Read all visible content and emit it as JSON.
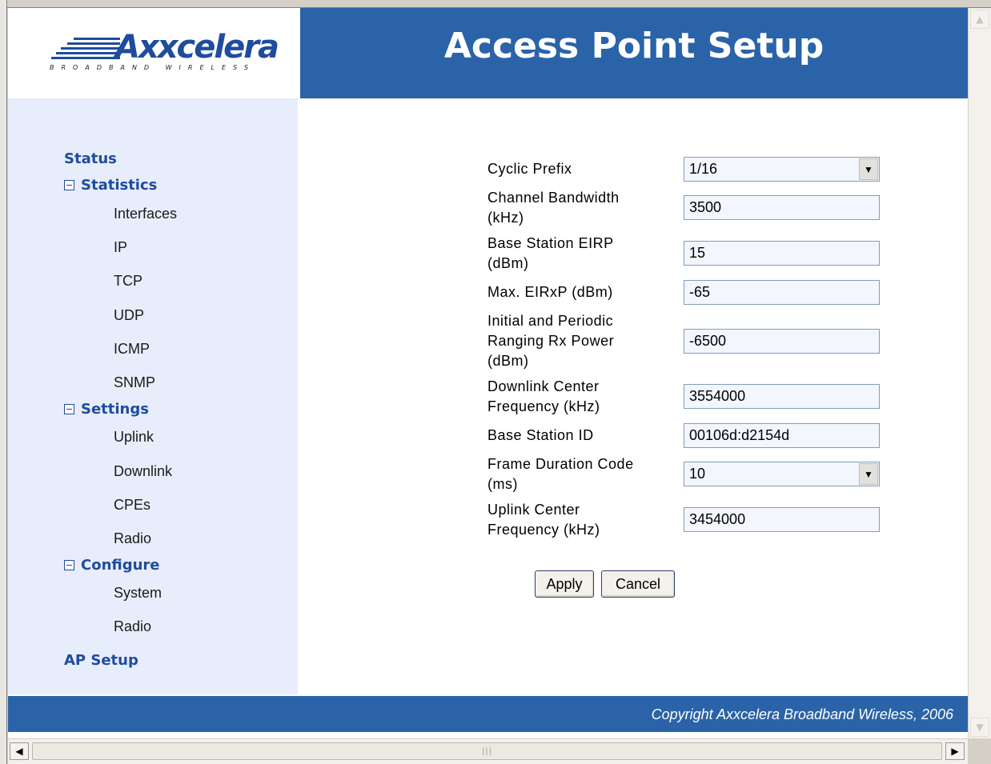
{
  "branding": {
    "logo_name": "Axxcelera",
    "logo_tagline": "BROADBAND WIRELESS",
    "brand_color": "#1f4c9c",
    "header_color": "#2a63a8"
  },
  "header": {
    "title": "Access Point Setup"
  },
  "sidebar": {
    "status": "Status",
    "statistics": {
      "label": "Statistics",
      "items": [
        "Interfaces",
        "IP",
        "TCP",
        "UDP",
        "ICMP",
        "SNMP"
      ]
    },
    "settings": {
      "label": "Settings",
      "items": [
        "Uplink",
        "Downlink",
        "CPEs",
        "Radio"
      ]
    },
    "configure": {
      "label": "Configure",
      "items": [
        "System",
        "Radio"
      ]
    },
    "ap_setup": "AP Setup"
  },
  "form": {
    "cyclic_prefix": {
      "label": "Cyclic Prefix",
      "value": "1/16"
    },
    "channel_bandwidth": {
      "label": "Channel Bandwidth (kHz)",
      "value": "3500"
    },
    "base_station_eirp": {
      "label": "Base Station EIRP (dBm)",
      "value": "15"
    },
    "max_eirxp": {
      "label": "Max. EIRxP (dBm)",
      "value": "-65"
    },
    "ranging_rx_power": {
      "label": "Initial and Periodic Ranging Rx Power (dBm)",
      "value": "-6500"
    },
    "downlink_center_freq": {
      "label": "Downlink Center Frequency (kHz)",
      "value": "3554000"
    },
    "base_station_id": {
      "label": "Base Station ID",
      "value": "00106d:d2154d"
    },
    "frame_duration_code": {
      "label": "Frame Duration Code (ms)",
      "value": "10"
    },
    "uplink_center_freq": {
      "label": "Uplink Center Frequency (kHz)",
      "value": "3454000"
    }
  },
  "buttons": {
    "apply": "Apply",
    "cancel": "Cancel"
  },
  "footer": {
    "copyright": "Copyright Axxcelera Broadband Wireless, 2006"
  },
  "icons": {
    "dropdown": "chevron-down-icon",
    "collapse": "minus-box-icon",
    "scroll_left": "arrow-left-icon",
    "scroll_right": "arrow-right-icon",
    "scroll_up": "arrow-up-icon",
    "scroll_down": "arrow-down-icon"
  }
}
